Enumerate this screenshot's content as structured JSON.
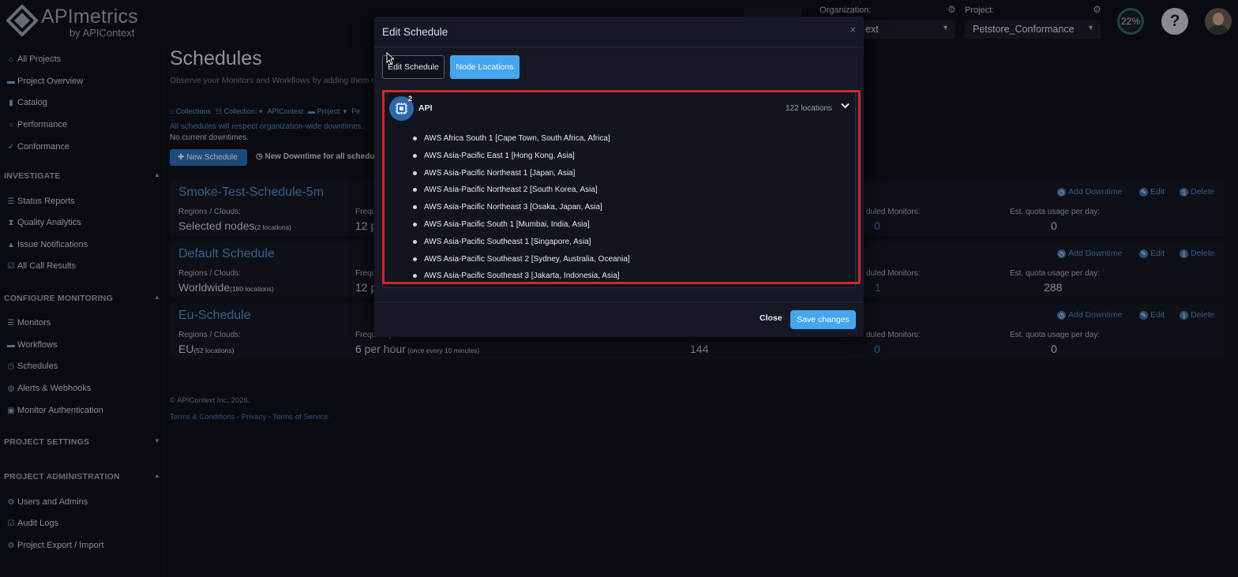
{
  "brand": {
    "name": "APImetrics",
    "sub": "by APIContext"
  },
  "topbar": {
    "org_label": "Organization:",
    "org_value": "ext",
    "project_label": "Project:",
    "project_value": "Petstore_Conformance",
    "quota_percent": "22%",
    "help_glyph": "?"
  },
  "sidebar": {
    "top_items": [
      "All Projects",
      "Project Overview",
      "Catalog",
      "Performance",
      "Conformance"
    ],
    "investigate": {
      "title": "INVESTIGATE",
      "items": [
        "Status Reports",
        "Quality Analytics",
        "Issue Notifications",
        "All Call Results"
      ]
    },
    "configure": {
      "title": "CONFIGURE MONITORING",
      "items": [
        "Monitors",
        "Workflows",
        "Schedules",
        "Alerts & Webhooks",
        "Monitor Authentication"
      ]
    },
    "settings": {
      "title": "PROJECT SETTINGS"
    },
    "admin": {
      "title": "PROJECT ADMINISTRATION",
      "items": [
        "Users and Admins",
        "Audit Logs",
        "Project Export / Import"
      ]
    }
  },
  "page": {
    "title": "Schedules",
    "subtitle": "Observe your Monitors and Workflows by adding them to",
    "crumbs": [
      "Collections",
      "Collection:",
      "APIContext",
      "Project:",
      "Pe"
    ],
    "downtime_note": "All schedules will respect organization-wide downtimes.",
    "current_downtimes": "No current downtimes.",
    "new_schedule": "New Schedule",
    "new_downtime": "New Downtime for all schedul"
  },
  "schedules": [
    {
      "name": "Smoke-Test-Schedule-5m",
      "regions_label": "Regions / Clouds:",
      "regions_value": "Selected nodes",
      "regions_note": "(2 locations)",
      "freq_label": "Freque",
      "freq_value": "12 p",
      "freq_note": "",
      "calls_label": "",
      "calls_value": "",
      "monitors_label": "duled Monitors:",
      "monitors_value": "0",
      "quota_label": "Est. quota usage per day:",
      "quota_value": "0"
    },
    {
      "name": "Default Schedule",
      "regions_label": "Regions / Clouds:",
      "regions_value": "Worldwide",
      "regions_note": "(180 locations)",
      "freq_label": "Freque",
      "freq_value": "12 p",
      "freq_note": "",
      "calls_label": "",
      "calls_value": "",
      "monitors_label": "duled Monitors:",
      "monitors_value": "1",
      "quota_label": "Est. quota usage per day:",
      "quota_value": "288"
    },
    {
      "name": "Eu-Schedule",
      "regions_label": "Regions / Clouds:",
      "regions_value": "EU",
      "regions_note": "(52 locations)",
      "freq_label": "Frequency:",
      "freq_value": "6 per hour",
      "freq_note": " (once every 10 minutes)",
      "calls_label": "",
      "calls_value": "144",
      "monitors_label": "duled Monitors:",
      "monitors_value": "0",
      "quota_label": "Est. quota usage per day:",
      "quota_value": "0"
    }
  ],
  "card_actions": {
    "add_downtime": "Add Downtime",
    "edit": "Edit",
    "delete": "Delete"
  },
  "footer": {
    "copyright": "© APIContext Inc, 2026.",
    "terms": "Terms & Conditions",
    "privacy": "Privacy",
    "tos": "Terms of Service",
    "separator": " - "
  },
  "modal": {
    "title": "Edit Schedule",
    "close_glyph": "×",
    "tab_edit": "Edit Schedule",
    "tab_nodes": "Node Locations",
    "group": {
      "name": "API",
      "badge": "2",
      "count": "122 locations"
    },
    "locations": [
      "AWS Africa South 1 [Cape Town, South Africa, Africa]",
      "AWS Asia-Pacific East 1 [Hong Kong, Asia]",
      "AWS Asia-Pacific Northeast 1 [Japan, Asia]",
      "AWS Asia-Pacific Northeast 2 [South Korea, Asia]",
      "AWS Asia-Pacific Northeast 3 [Osaka, Japan, Asia]",
      "AWS Asia-Pacific South 1 [Mumbai, India, Asia]",
      "AWS Asia-Pacific Southeast 1 [Singapore, Asia]",
      "AWS Asia-Pacific Southeast 2 [Sydney, Australia, Oceania]",
      "AWS Asia-Pacific Southeast 3 [Jakarta, Indonesia, Asia]"
    ],
    "close_label": "Close",
    "save_label": "Save changes"
  },
  "colors": {
    "accent": "#45a6ee",
    "link": "#4d8ed0",
    "highlight": "#d3262b"
  }
}
